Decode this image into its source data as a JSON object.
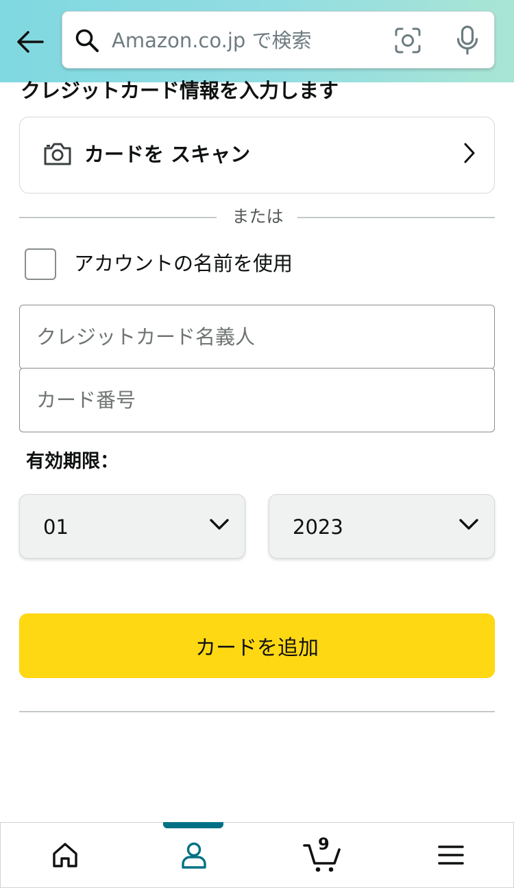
{
  "header": {
    "search": {
      "placeholder": "Amazon.co.jp で検索"
    },
    "icons": [
      "back-arrow-icon",
      "search-icon",
      "camera-search-icon",
      "microphone-icon"
    ]
  },
  "form": {
    "section_title": "クレジットカード情報を入力します",
    "scan_card_label": "カードを スキャン",
    "divider_text": "または",
    "use_account_name_label": "アカウントの名前を使用",
    "use_account_name_checked": false,
    "cardholder_name": {
      "placeholder": "クレジットカード名義人",
      "value": ""
    },
    "card_number": {
      "placeholder": "カード番号",
      "value": ""
    },
    "expiry_label": "有効期限：",
    "expiry_month": "01",
    "expiry_year": "2023",
    "add_card_button": "カードを追加"
  },
  "bottom_nav": {
    "items": [
      "home",
      "account",
      "cart",
      "menu"
    ],
    "active": "account",
    "cart_count": "9"
  },
  "colors": {
    "header_gradient_start": "#80d8e0",
    "header_gradient_end": "#a9e5d4",
    "primary_button": "#ffd814",
    "active_accent": "#007185",
    "dropdown_bg": "#f0f2f2"
  }
}
